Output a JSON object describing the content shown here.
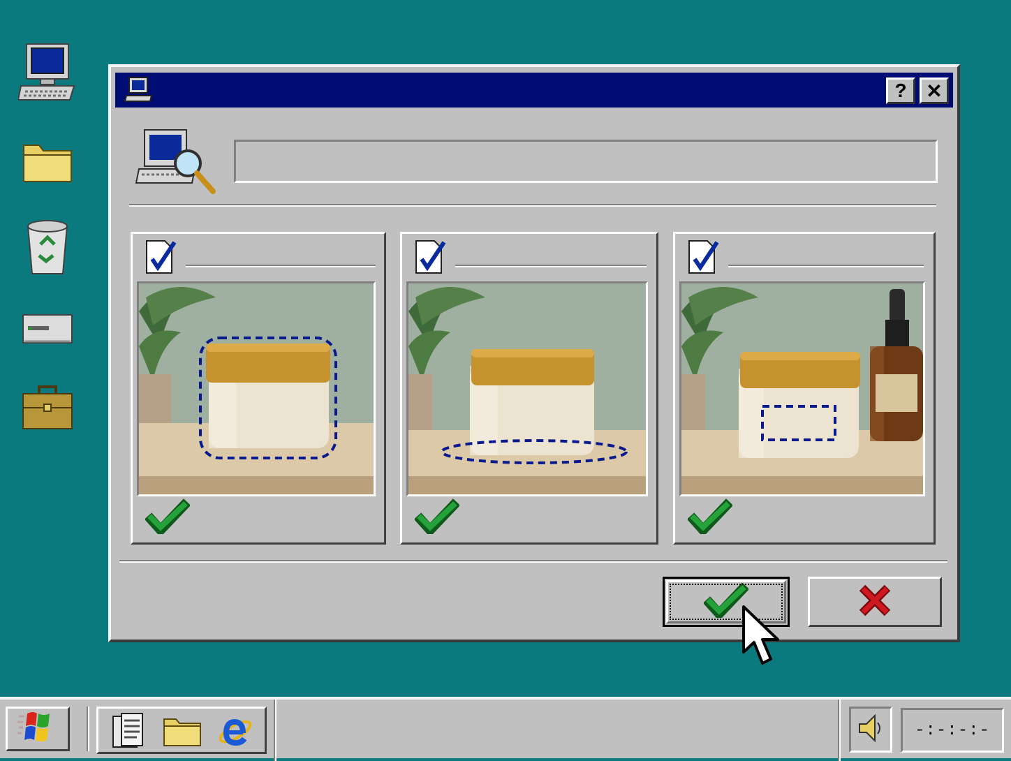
{
  "desktop": {
    "icons": [
      {
        "name": "my-computer-icon"
      },
      {
        "name": "folder-icon"
      },
      {
        "name": "recycle-bin-icon"
      },
      {
        "name": "drive-icon"
      },
      {
        "name": "briefcase-icon"
      }
    ]
  },
  "dialog": {
    "title": "",
    "title_icon": "computer-icon",
    "help_label": "?",
    "close_label": "✕",
    "header_icon": "computer-search-icon",
    "path_value": "",
    "panels": [
      {
        "icon": "checked-document-icon",
        "label": "",
        "image": "cream-jar-product-photo",
        "highlight": "jar-outline",
        "status": "checkmark"
      },
      {
        "icon": "checked-document-icon",
        "label": "",
        "image": "cream-jar-product-photo",
        "highlight": "jar-base-ellipse",
        "status": "checkmark"
      },
      {
        "icon": "checked-document-icon",
        "label": "",
        "image": "cream-jar-with-dropper-bottle-photo",
        "highlight": "label-rectangle",
        "status": "checkmark"
      }
    ],
    "ok_icon": "green-checkmark-icon",
    "cancel_icon": "red-x-icon"
  },
  "taskbar": {
    "start_icon": "windows-logo-icon",
    "quicklaunch": [
      "document-icon",
      "folder-icon",
      "internet-explorer-icon"
    ],
    "tray_icon": "speaker-icon",
    "clock": "-:-:-:-"
  },
  "colors": {
    "desktop": "#0b7a7f",
    "titlebar": "#000c74",
    "face": "#c0c0c0",
    "check_green": "#1a8a2a",
    "cancel_red": "#c8141c",
    "highlight_dash": "#0a1a8c"
  }
}
